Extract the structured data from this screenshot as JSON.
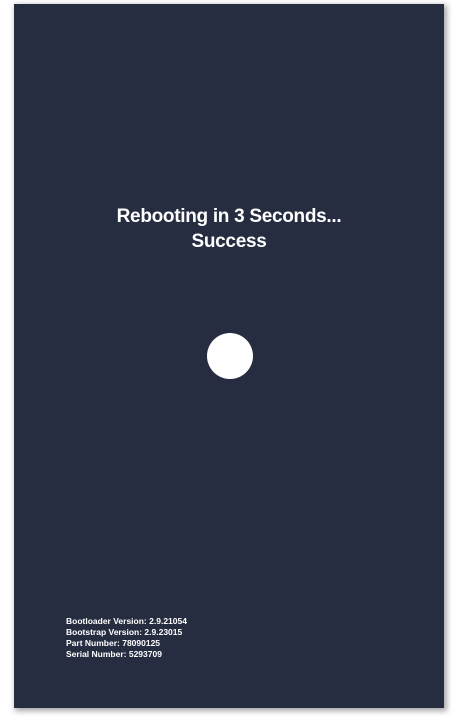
{
  "status": {
    "line1": "Rebooting in 3 Seconds...",
    "line2": "Success"
  },
  "indicator": {
    "color": "#ffffff"
  },
  "device_info": [
    {
      "label": "Bootloader Version:",
      "value": "2.9.21054"
    },
    {
      "label": "Bootstrap Version:",
      "value": "2.9.23015"
    },
    {
      "label": "Part Number:",
      "value": "78090125"
    },
    {
      "label": "Serial Number:",
      "value": "5293709"
    }
  ],
  "colors": {
    "background": "#262d40",
    "text": "#ffffff"
  }
}
